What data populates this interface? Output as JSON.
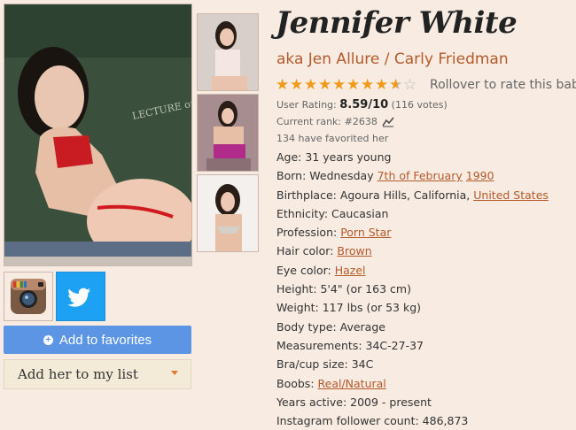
{
  "profile": {
    "name": "Jennifer White",
    "aka": "aka Jen Allure / Carly Friedman",
    "rating_stars": 8.59,
    "rollover_text": "Rollover to rate this babe",
    "user_rating_label": "User Rating:",
    "user_rating_value": "8.59/10",
    "user_rating_votes": "(116 votes)",
    "current_rank": "Current rank: #2638",
    "favorited": "134 have favorited her",
    "chalkboard_text": "LECTURE on EARLY ART I THEIR I"
  },
  "actions": {
    "favorites_label": "Add to favorites",
    "list_label": "Add her to my list"
  },
  "facts": {
    "age": "Age: 31 years young",
    "born_prefix": "Born: Wednesday ",
    "born_date": "7th of February",
    "born_year": "1990",
    "birthplace_prefix": "Birthplace: Agoura Hills, California, ",
    "birthplace_country": "United States",
    "ethnicity": "Ethnicity: Caucasian",
    "profession_prefix": "Profession: ",
    "profession": "Porn Star",
    "hair_prefix": "Hair color: ",
    "hair": "Brown",
    "eye_prefix": "Eye color: ",
    "eye": "Hazel",
    "height": "Height: 5'4\" (or 163 cm)",
    "weight": "Weight: 117 lbs (or 53 kg)",
    "body_type": "Body type: Average",
    "measurements": "Measurements: 34C-27-37",
    "bra": "Bra/cup size: 34C",
    "boobs_prefix": "Boobs: ",
    "boobs": "Real/Natural",
    "years_active": "Years active: 2009 - present",
    "instagram": "Instagram follower count: 486,873"
  },
  "colors": {
    "background": "#f7ebe2",
    "link": "#b55a2b",
    "star": "#f39a1a",
    "favorites_button": "#5b95e4",
    "twitter": "#1da1f2"
  },
  "icons": [
    "instagram-icon",
    "twitter-bird-icon",
    "plus-icon",
    "caret-down-icon",
    "rank-chart-icon",
    "star-icon"
  ]
}
